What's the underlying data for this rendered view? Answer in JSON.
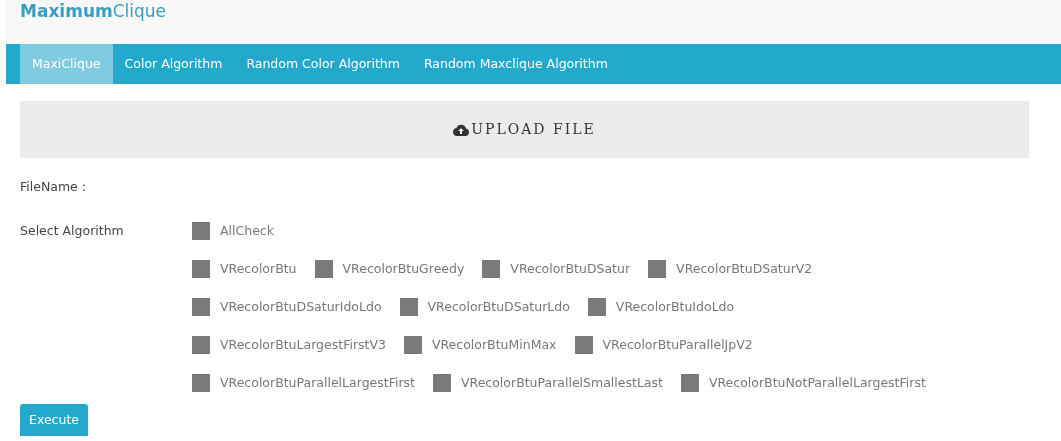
{
  "brand": {
    "bold": "Maximum",
    "light": "Clique"
  },
  "tabs": [
    {
      "label": "MaxiClique",
      "selected": true
    },
    {
      "label": "Color Algorithm",
      "selected": false
    },
    {
      "label": "Random Color Algorithm",
      "selected": false
    },
    {
      "label": "Random Maxclique Algorithm",
      "selected": false
    }
  ],
  "upload": {
    "label": "UPLOAD FILE"
  },
  "file_name_label": "FileName :",
  "select_label": "Select Algorithm",
  "all_check": {
    "label": "AllCheck",
    "checked": false
  },
  "algorithm_rows": [
    [
      {
        "label": "VRecolorBtu",
        "checked": false
      },
      {
        "label": "VRecolorBtuGreedy",
        "checked": false
      },
      {
        "label": "VRecolorBtuDSatur",
        "checked": false
      },
      {
        "label": "VRecolorBtuDSaturV2",
        "checked": false
      }
    ],
    [
      {
        "label": "VRecolorBtuDSaturIdoLdo",
        "checked": false
      },
      {
        "label": "VRecolorBtuDSaturLdo",
        "checked": false
      },
      {
        "label": "VRecolorBtuIdoLdo",
        "checked": false
      }
    ],
    [
      {
        "label": "VRecolorBtuLargestFirstV3",
        "checked": false
      },
      {
        "label": "VRecolorBtuMinMax",
        "checked": false
      },
      {
        "label": "VRecolorBtuParallelJpV2",
        "checked": false
      }
    ],
    [
      {
        "label": "VRecolorBtuParallelLargestFirst",
        "checked": false
      },
      {
        "label": "VRecolorBtuParallelSmallestLast",
        "checked": false
      },
      {
        "label": "VRecolorBtuNotParallelLargestFirst",
        "checked": false
      }
    ]
  ],
  "execute_button": "Execute"
}
